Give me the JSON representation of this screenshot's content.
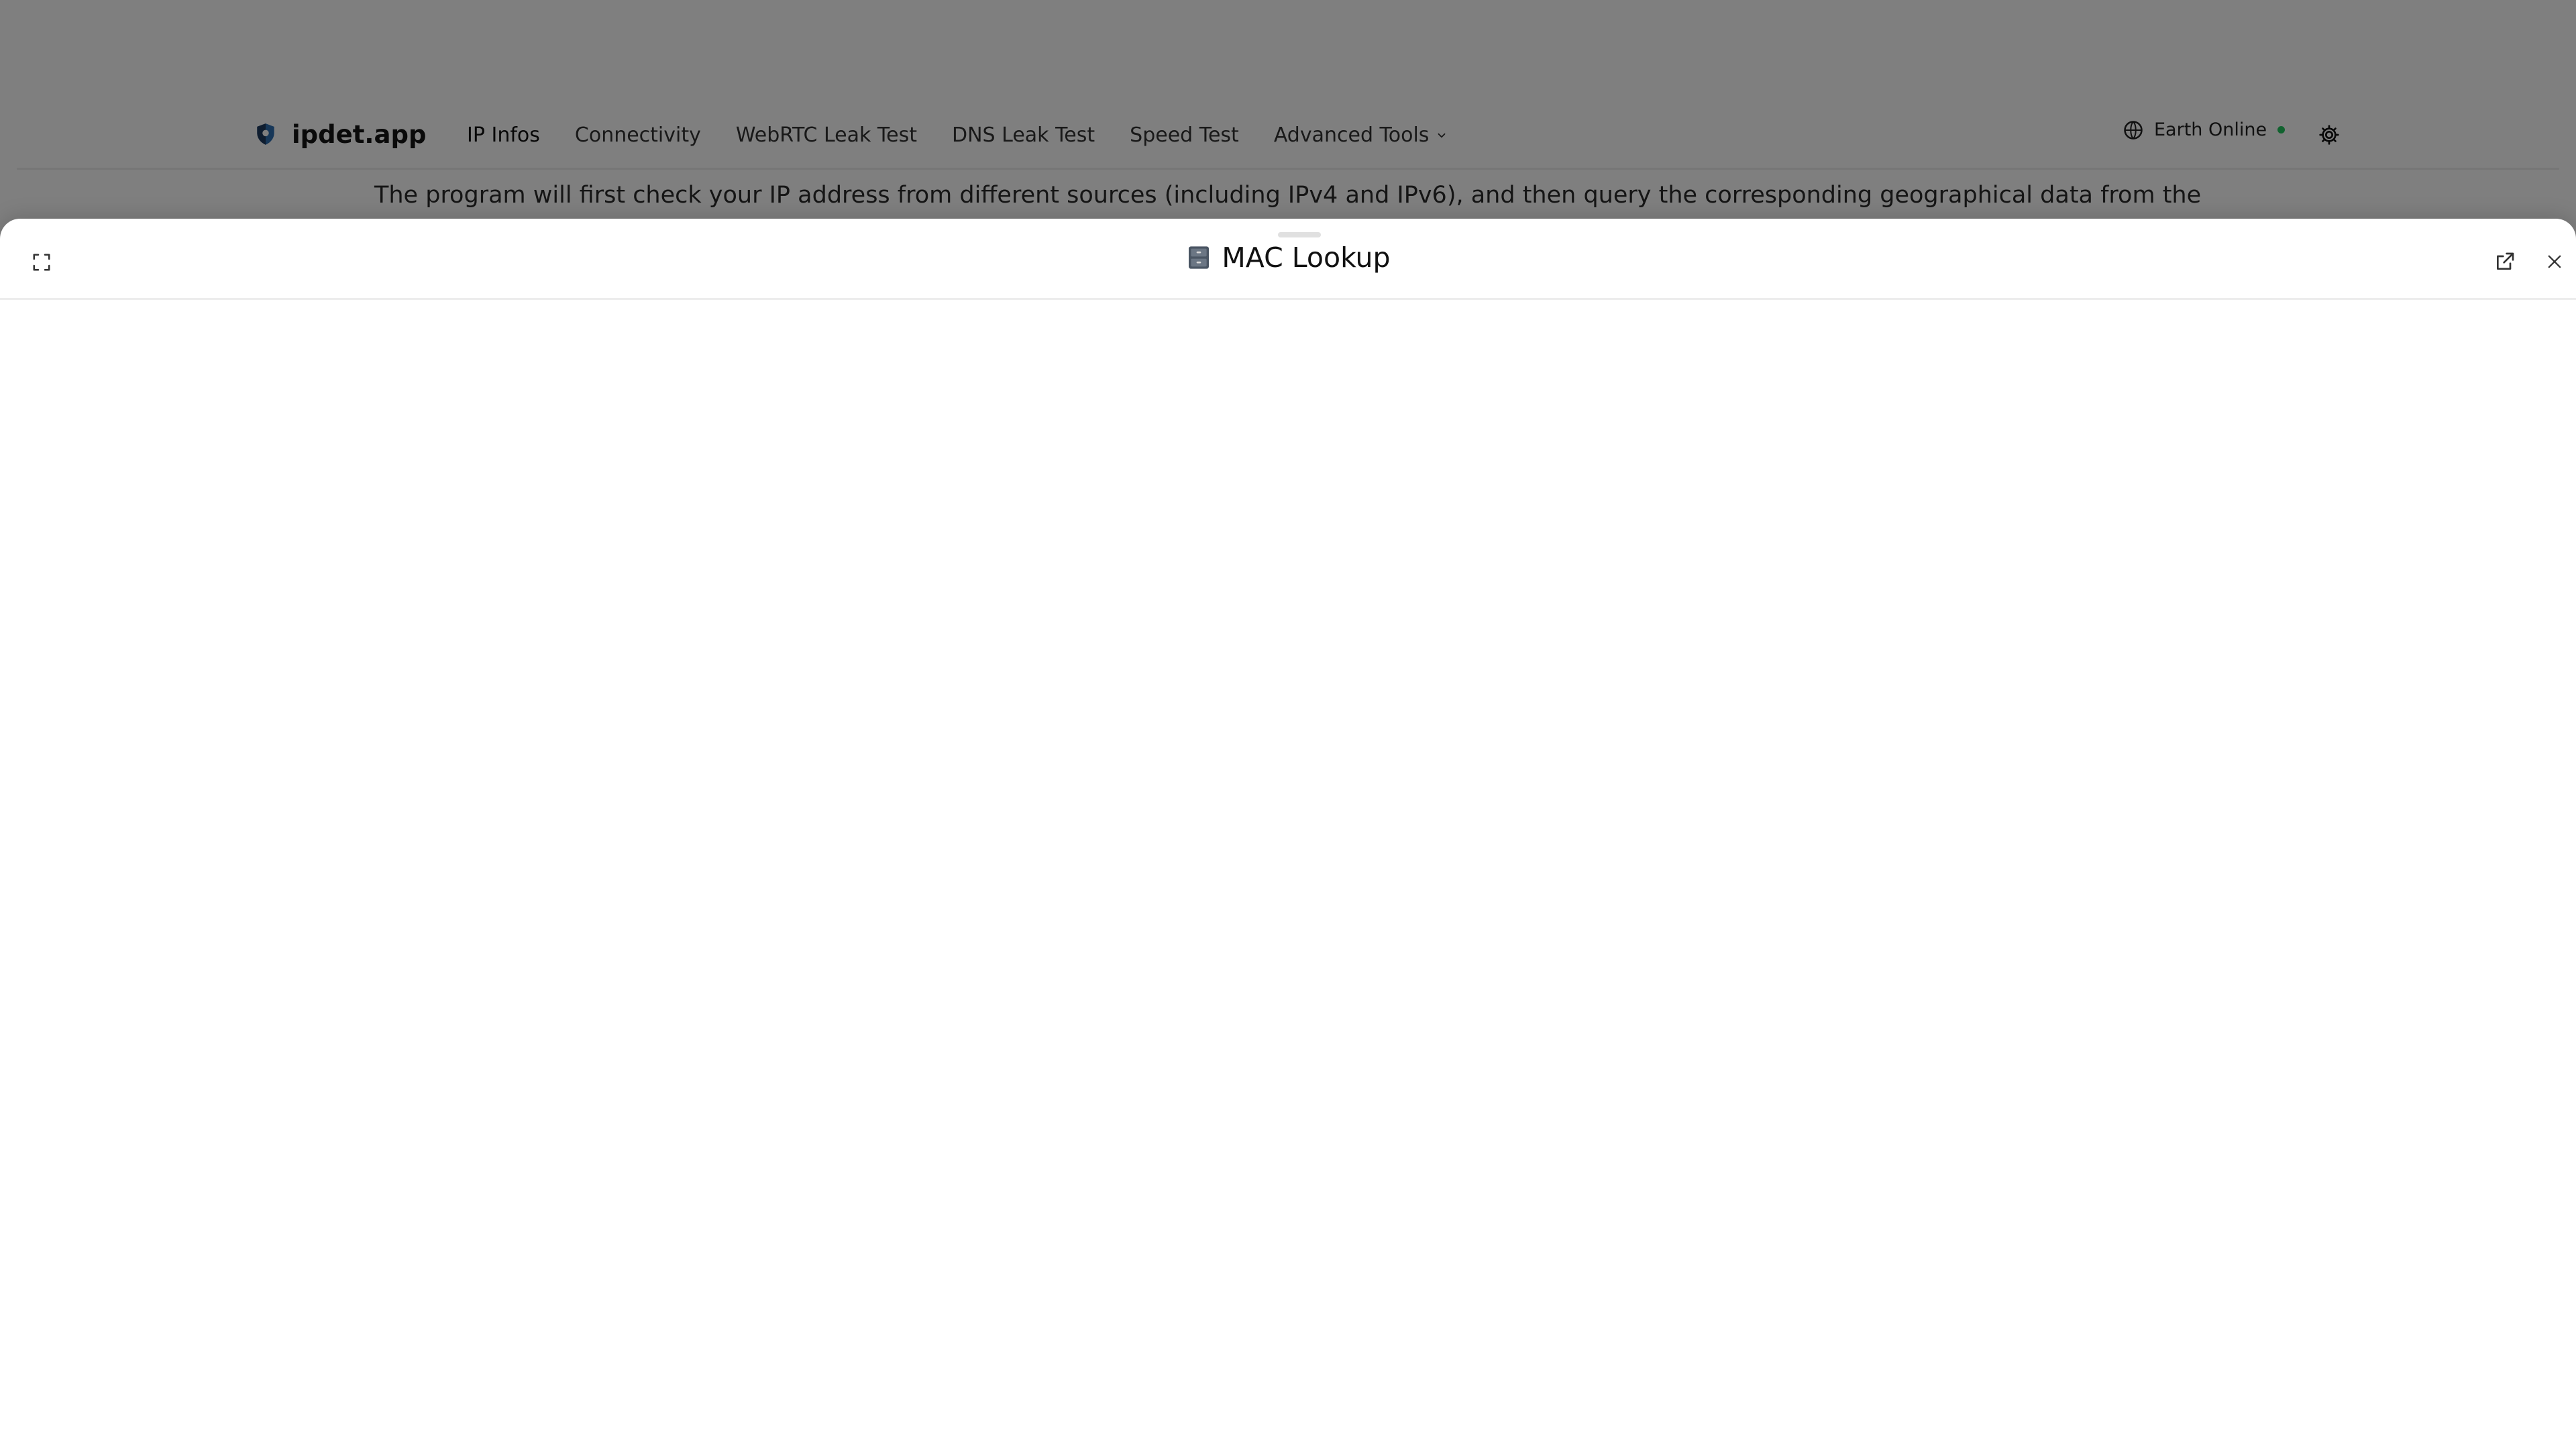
{
  "header": {
    "brand": "ipdet.app",
    "nav": [
      {
        "label": "IP Infos"
      },
      {
        "label": "Connectivity"
      },
      {
        "label": "WebRTC Leak Test"
      },
      {
        "label": "DNS Leak Test"
      },
      {
        "label": "Speed Test"
      },
      {
        "label": "Advanced Tools"
      }
    ],
    "status_label": "Earth Online",
    "status_color": "#22c55e"
  },
  "main": {
    "intro": "The program will first check your IP address from different sources (including IPv4 and IPv6), and then query the corresponding geographical data from the IP geolocation"
  },
  "drawer": {
    "title": "MAC Lookup",
    "title_icon": "file-cabinet-icon"
  },
  "icons": {
    "brand": "shield-logo-icon",
    "advanced_tools": "chevron-down-icon",
    "status": "globe-icon",
    "settings": "gear-icon",
    "fullscreen": "fullscreen-icon",
    "open_external": "external-link-icon",
    "close": "close-icon"
  }
}
